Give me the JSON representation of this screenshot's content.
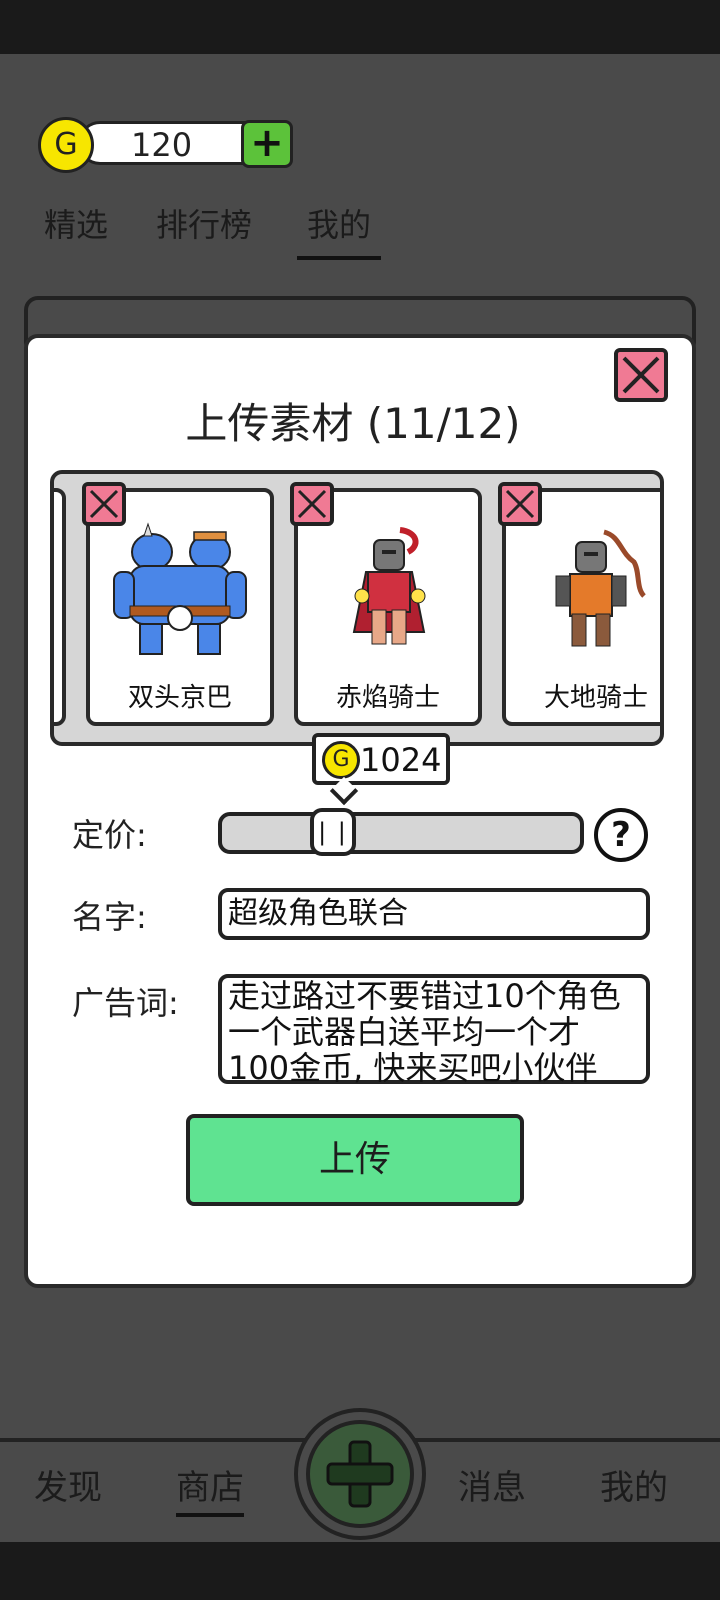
{
  "coins": {
    "icon": "G",
    "value": "120",
    "add_label": "+"
  },
  "top_tabs": [
    {
      "label": "精选",
      "active": false
    },
    {
      "label": "排行榜",
      "active": false
    },
    {
      "label": "我的",
      "active": true
    }
  ],
  "modal": {
    "title": "上传素材 (11/12)",
    "close_icon": "close-x-icon",
    "cards": [
      {
        "name": "双头京巴",
        "art": "two-headed-blue-ogre"
      },
      {
        "name": "赤焰骑士",
        "art": "red-flame-knight"
      },
      {
        "name": "大地骑士",
        "art": "orange-earth-knight"
      }
    ],
    "price": {
      "label": "定价:",
      "coin_icon": "G",
      "value": "1024",
      "thumb": "| |"
    },
    "name": {
      "label": "名字:",
      "value": "超级角色联合"
    },
    "ad": {
      "label": "广告词:",
      "value": "走过路过不要错过10个角色一个武器白送平均一个才100金币, 快来买吧小伙伴"
    },
    "help_label": "?",
    "upload_label": "上传"
  },
  "bottom_nav": [
    {
      "label": "发现",
      "active": false
    },
    {
      "label": "商店",
      "active": true
    },
    {
      "label": "消息",
      "active": false
    },
    {
      "label": "我的",
      "active": false
    }
  ],
  "colors": {
    "accent_green": "#5fe391",
    "remove_pink": "#f07a94",
    "coin_yellow": "#f7e600",
    "overlay": "#4a4a4a"
  }
}
